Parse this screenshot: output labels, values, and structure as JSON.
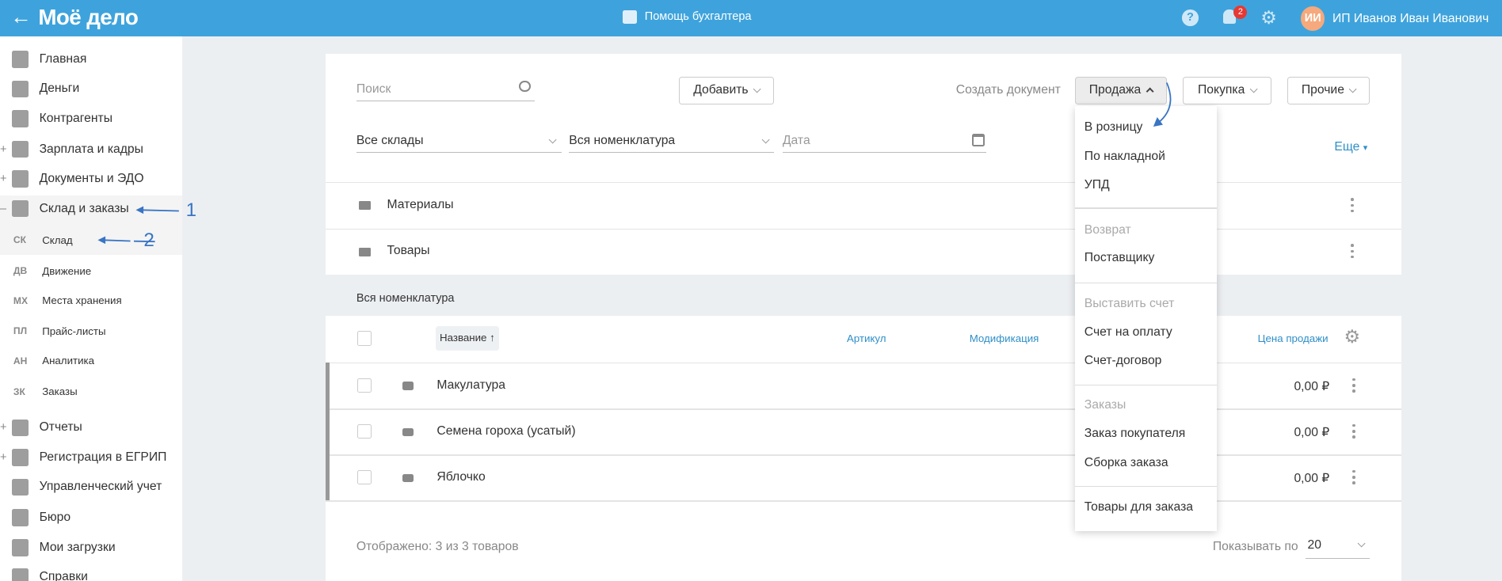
{
  "header": {
    "logo": "Моё дело",
    "center_label": "Помощь бухгалтера",
    "notification_count": "2",
    "avatar_initials": "ИИ",
    "user_name": "ИП Иванов Иван Иванович",
    "accent": "#3ea3dc"
  },
  "sidebar": {
    "items": [
      {
        "label": "Главная",
        "icon": "home-icon"
      },
      {
        "label": "Деньги",
        "icon": "money-icon"
      },
      {
        "label": "Контрагенты",
        "icon": "person-icon"
      },
      {
        "label": "Зарплата и кадры",
        "icon": "wallet-icon",
        "expand": "+"
      },
      {
        "label": "Документы и ЭДО",
        "icon": "folder-icon",
        "expand": "+"
      },
      {
        "label": "Склад и заказы",
        "icon": "warehouse-icon",
        "expand": "–"
      }
    ],
    "sub_items": [
      {
        "abbr": "СК",
        "label": "Склад"
      },
      {
        "abbr": "ДВ",
        "label": "Движение"
      },
      {
        "abbr": "МХ",
        "label": "Места хранения"
      },
      {
        "abbr": "ПЛ",
        "label": "Прайс-листы"
      },
      {
        "abbr": "АН",
        "label": "Аналитика"
      },
      {
        "abbr": "ЗК",
        "label": "Заказы"
      }
    ],
    "items2": [
      {
        "label": "Отчеты",
        "icon": "report-icon",
        "expand": "+"
      },
      {
        "label": "Регистрация в ЕГРИП",
        "icon": "registration-icon",
        "expand": "+"
      },
      {
        "label": "Управленческий учет",
        "icon": "ruble-icon"
      },
      {
        "label": "Бюро",
        "icon": "briefcase-icon"
      },
      {
        "label": "Мои загрузки",
        "icon": "folder-icon"
      },
      {
        "label": "Справки",
        "icon": "card-icon"
      }
    ]
  },
  "annotations": {
    "one": "1",
    "two": "2"
  },
  "toolbar": {
    "search_placeholder": "Поиск",
    "add_label": "Добавить",
    "create_label": "Создать документ",
    "sale_label": "Продажа",
    "purchase_label": "Покупка",
    "other_label": "Прочие",
    "warehouse_filter": "Все склады",
    "nomenclature_filter": "Вся номенклатура",
    "date_placeholder": "Дата",
    "more_label": "Еще"
  },
  "folders": [
    "Материалы",
    "Товары"
  ],
  "section_title": "Вся номенклатура",
  "table": {
    "columns": {
      "name": "Название ↑",
      "article": "Артикул",
      "modification": "Модификация",
      "price": "Цена продажи"
    },
    "rows": [
      {
        "name": "Макулатура",
        "price": "0,00 ₽"
      },
      {
        "name": "Семена гороха (усатый)",
        "price": "0,00 ₽"
      },
      {
        "name": "Яблочко",
        "price": "0,00 ₽"
      }
    ]
  },
  "footer": {
    "shown": "Отображено: 3 из 3 товаров",
    "per_page_label": "Показывать по",
    "per_page": "20"
  },
  "dropdown": {
    "items": [
      "В розницу",
      "По накладной",
      "УПД"
    ],
    "return_header": "Возврат",
    "return_items": [
      "Поставщику"
    ],
    "invoice_header": "Выставить счет",
    "invoice_items": [
      "Счет на оплату",
      "Счет-договор"
    ],
    "orders_header": "Заказы",
    "orders_items": [
      "Заказ покупателя",
      "Сборка заказа"
    ],
    "last_item": "Товары для заказа"
  }
}
